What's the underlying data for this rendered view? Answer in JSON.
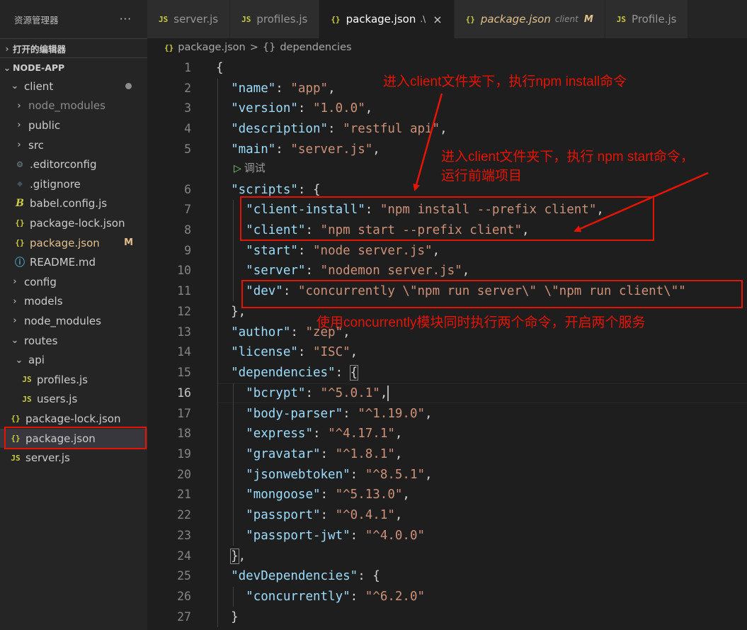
{
  "sidebar": {
    "title": "资源管理器",
    "more_icon": "ellipsis-icon",
    "open_editors_label": "打开的编辑器",
    "project_label": "NODE-APP",
    "items": [
      {
        "label": "client",
        "type": "folder-open",
        "status": "modified-dot"
      },
      {
        "label": "node_modules",
        "type": "folder",
        "dimmed": true
      },
      {
        "label": "public",
        "type": "folder"
      },
      {
        "label": "src",
        "type": "folder"
      },
      {
        "label": ".editorconfig",
        "type": "gear-file"
      },
      {
        "label": ".gitignore",
        "type": "git-file"
      },
      {
        "label": "babel.config.js",
        "type": "babel-file"
      },
      {
        "label": "package-lock.json",
        "type": "json"
      },
      {
        "label": "package.json",
        "type": "json",
        "badge": "M"
      },
      {
        "label": "README.md",
        "type": "info-file"
      },
      {
        "label": "config",
        "type": "folder"
      },
      {
        "label": "models",
        "type": "folder"
      },
      {
        "label": "node_modules",
        "type": "folder"
      },
      {
        "label": "routes",
        "type": "folder-open"
      },
      {
        "label": "api",
        "type": "folder-open"
      },
      {
        "label": "profiles.js",
        "type": "js"
      },
      {
        "label": "users.js",
        "type": "js"
      },
      {
        "label": "package-lock.json",
        "type": "json"
      },
      {
        "label": "package.json",
        "type": "json",
        "selected": true
      },
      {
        "label": "server.js",
        "type": "js"
      }
    ]
  },
  "tabs": [
    {
      "icon": "JS",
      "label": "server.js"
    },
    {
      "icon": "JS",
      "label": "profiles.js"
    },
    {
      "icon": "{}",
      "label": "package.json",
      "hint": ".\\",
      "active": true,
      "close": "×"
    },
    {
      "icon": "{}",
      "label": "package.json",
      "hint": "client",
      "badge": "M",
      "italic": true
    },
    {
      "icon": "JS",
      "label": "Profile.js"
    }
  ],
  "breadcrumb": {
    "file_icon": "{}",
    "file": "package.json",
    "separator": ">",
    "symbol_icon": "{}",
    "symbol": "dependencies"
  },
  "editor": {
    "codelens": "调试",
    "lines": [
      "{",
      "  \"name\": \"app\",",
      "  \"version\": \"1.0.0\",",
      "  \"description\": \"restful api\",",
      "  \"main\": \"server.js\",",
      "  \"scripts\": {",
      "    \"client-install\": \"npm install --prefix client\",",
      "    \"client\": \"npm start --prefix client\",",
      "    \"start\": \"node server.js\",",
      "    \"server\": \"nodemon server.js\",",
      "    \"dev\": \"concurrently \\\"npm run server\\\" \\\"npm run client\\\"\"",
      "  },",
      "  \"author\": \"zep\",",
      "  \"license\": \"ISC\",",
      "  \"dependencies\": {",
      "    \"bcrypt\": \"^5.0.1\",",
      "    \"body-parser\": \"^1.19.0\",",
      "    \"express\": \"^4.17.1\",",
      "    \"gravatar\": \"^1.8.1\",",
      "    \"jsonwebtoken\": \"^8.5.1\",",
      "    \"mongoose\": \"^5.13.0\",",
      "    \"passport\": \"^0.4.1\",",
      "    \"passport-jwt\": \"^4.0.0\"",
      "  },",
      "  \"devDependencies\": {",
      "    \"concurrently\": \"^6.2.0\"",
      "  }"
    ],
    "current_line": 16
  },
  "annotations": {
    "install_note": "进入client文件夹下，执行npm install命令",
    "start_note_line1": "进入client文件夹下，执行 npm start命令，",
    "start_note_line2": "运行前端项目",
    "concurrently_note": "使用concurrently模块同时执行两个命令，开启两个服务",
    "color": "#e51400"
  },
  "colors": {
    "key": "#9cdcfe",
    "string": "#ce9178",
    "punctuation": "#d4d4d4",
    "modified": "#e2c08d",
    "js_icon": "#cbcb41"
  }
}
